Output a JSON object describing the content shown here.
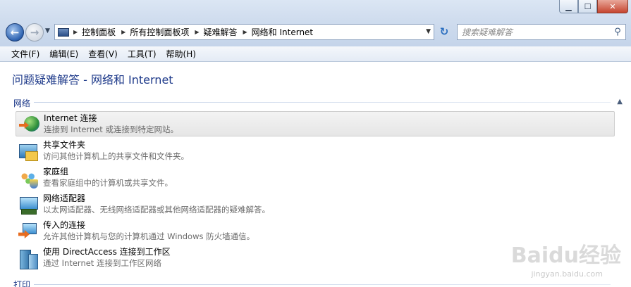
{
  "window": {
    "minimize_label": "▁",
    "maximize_label": "☐",
    "close_label": "✕"
  },
  "nav": {
    "back_icon": "back-arrow-icon",
    "forward_icon": "forward-arrow-icon"
  },
  "address": {
    "breadcrumbs": [
      "控制面板",
      "所有控制面板项",
      "疑难解答",
      "网络和 Internet"
    ]
  },
  "search": {
    "placeholder": "搜索疑难解答"
  },
  "menubar": {
    "items": [
      "文件(F)",
      "编辑(E)",
      "查看(V)",
      "工具(T)",
      "帮助(H)"
    ]
  },
  "main": {
    "title": "问题疑难解答 - 网络和 Internet",
    "sections": [
      {
        "header": "网络",
        "items": [
          {
            "title": "Internet 连接",
            "desc": "连接到 Internet 或连接到特定网站。",
            "icon": "globe-arrow-icon"
          },
          {
            "title": "共享文件夹",
            "desc": "访问其他计算机上的共享文件和文件夹。",
            "icon": "shared-folder-icon"
          },
          {
            "title": "家庭组",
            "desc": "查看家庭组中的计算机或共享文件。",
            "icon": "homegroup-icon"
          },
          {
            "title": "网络适配器",
            "desc": "以太网适配器、无线网络适配器或其他网络适配器的疑难解答。",
            "icon": "network-adapter-icon"
          },
          {
            "title": "传入的连接",
            "desc": "允许其他计算机与您的计算机通过 Windows 防火墙通信。",
            "icon": "incoming-connection-icon"
          },
          {
            "title": "使用 DirectAccess 连接到工作区",
            "desc": "通过 Internet 连接到工作区网络",
            "icon": "directaccess-icon"
          }
        ]
      },
      {
        "header": "打印"
      }
    ]
  },
  "watermark": {
    "brand": "Baidu经验",
    "url": "jingyan.baidu.com"
  }
}
